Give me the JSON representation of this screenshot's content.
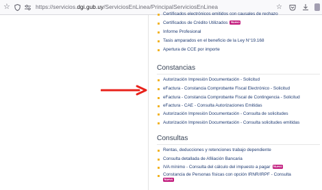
{
  "browser": {
    "url_prefix": "https://servicios.",
    "url_domain": "dgi.gub.uy",
    "url_path": "/ServiciosEnLinea/PrincipalServiciosEnLinea"
  },
  "top_items": [
    {
      "label": "Certificados electrónicos emitidos con causales de rechazo"
    },
    {
      "label": "Certificados de Crédito Utilizados",
      "badge": "Nuevo"
    },
    {
      "label": "Informe Profesional"
    },
    {
      "label": "Tasis amparados en el beneficio de la Ley N°19.168"
    },
    {
      "label": "Apertura de CCE por importe"
    }
  ],
  "constancias": {
    "title": "Constancias",
    "items": [
      {
        "label": "Autorización Impresión Documentación - Solicitud"
      },
      {
        "label": "eFactura - Constancia Comprobante Fiscal Electrónico - Solicitud"
      },
      {
        "label": "eFactura - Constancia Comprobante Fiscal de Contingencia - Solicitud"
      },
      {
        "label": "eFactura - CAE - Consulta Autorizaciones Emitidas"
      },
      {
        "label": "Autorización Impresión Documentación - Consulta de solicitudes"
      },
      {
        "label": "Autorización Impresión Documentación - Consulta solicitudes emitidas"
      }
    ]
  },
  "consultas": {
    "title": "Consultas",
    "items": [
      {
        "label": "Rentas, deducciones y retenciones trabajo dependiente"
      },
      {
        "label": "Consulta detallada de Afiliación Bancaria"
      },
      {
        "label": "IVA mínimo - Consulta del cálculo del impuesto a pagar",
        "badge": "Nuevo"
      },
      {
        "label": "Constancia de Personas físicas con opción IRNR/IRPF - Consulta",
        "badge": "Nuevo"
      }
    ]
  },
  "colors": {
    "link": "#1f3b72",
    "bullet": "#f2b321",
    "badge": "#c0167a",
    "arrow": "#e8221b"
  }
}
